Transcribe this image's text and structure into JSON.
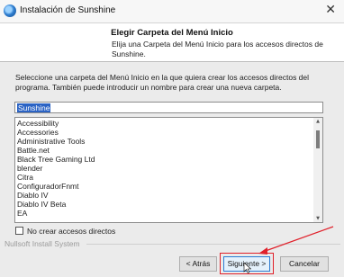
{
  "window": {
    "title": "Instalación de Sunshine",
    "close_glyph": "✕",
    "icon": "sunshine-app-icon"
  },
  "header": {
    "title": "Elegir Carpeta del Menú Inicio",
    "subtitle": "Elija una Carpeta del Menú Inicio para los accesos directos de Sunshine."
  },
  "body": {
    "instructions": "Seleccione una carpeta del Menú Inicio en la que quiera crear los accesos directos del programa. También puede introducir un nombre para crear una nueva carpeta.",
    "folder_input_value": "Sunshine",
    "folder_items": [
      "Accessibility",
      "Accessories",
      "Administrative Tools",
      "Battle.net",
      "Black Tree Gaming Ltd",
      "blender",
      "Citra",
      "ConfiguradorFnmt",
      "Diablo IV",
      "Diablo IV Beta",
      "EA"
    ],
    "no_shortcuts_label": "No crear accesos directos",
    "no_shortcuts_checked": false
  },
  "footer": {
    "brand": "Nullsoft Install System",
    "back_label": "< Atrás",
    "next_label": "Siguiente >",
    "cancel_label": "Cancelar"
  },
  "colors": {
    "annotation": "#e0202a",
    "selection": "#2b63c4",
    "default_button_border": "#2b7bd2"
  }
}
